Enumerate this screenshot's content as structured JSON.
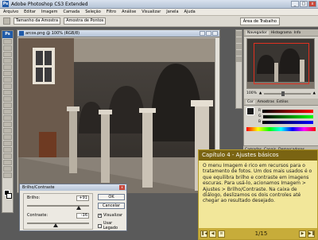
{
  "app": {
    "title": "Adobe Photoshop CS3 Extended",
    "logo": "Ps"
  },
  "window_controls": {
    "minimize": "_",
    "maximize": "□",
    "close": "x"
  },
  "menu": [
    "Arquivo",
    "Editar",
    "Imagem",
    "Camada",
    "Seleção",
    "Filtro",
    "Análise",
    "Visualizar",
    "Janela",
    "Ajuda"
  ],
  "options_bar": {
    "tool_size": "Tamanho da Amostra",
    "tool_sample": "Amostra de Pontos",
    "workspace": "Área de Trabalho"
  },
  "document": {
    "title": "arcos.png @ 100% (RGB/8)"
  },
  "navigator": {
    "tabs": [
      "Navegador",
      "Histograma",
      "Info"
    ],
    "zoom": "100%"
  },
  "color_panel": {
    "tabs": [
      "Cor",
      "Amostras",
      "Estilos"
    ],
    "channels": [
      "R",
      "G",
      "B"
    ]
  },
  "layers_panel": {
    "tabs": [
      "Camadas",
      "Canais",
      "Demarcadores"
    ]
  },
  "dialog": {
    "title": "Brilho/Contraste",
    "brightness_label": "Brilho:",
    "brightness_value": "+91",
    "contrast_label": "Contraste:",
    "contrast_value": "-16",
    "ok": "OK",
    "cancel": "Cancelar",
    "preview_label": "Visualizar",
    "preview_checked": true,
    "legacy_label": "Usar Legado",
    "legacy_checked": false
  },
  "chapter": {
    "title": "Capítulo 4 - Ajustes básicos",
    "body": "O menu Imagem é rico em recursos para o tratamento de fotos. Um dos mais usados é o que equilibra brilho e contraste em imagens escuras. Para usá-lo, acionamos Imagem > Ajustes > Brilho/Contraste. Na caixa de diálogo, deslizamos os dois controles até chegar ao resultado desejado.",
    "page": "1/15",
    "nav": {
      "first": "❚◀",
      "prev": "◀",
      "next": "▶",
      "last": "▶❚",
      "menu": "≡"
    }
  },
  "colors": {
    "chapter_bg": "#f2e79a",
    "chapter_title_bg": "#7a6412",
    "photoshop_blue": "#1f5aa8"
  }
}
